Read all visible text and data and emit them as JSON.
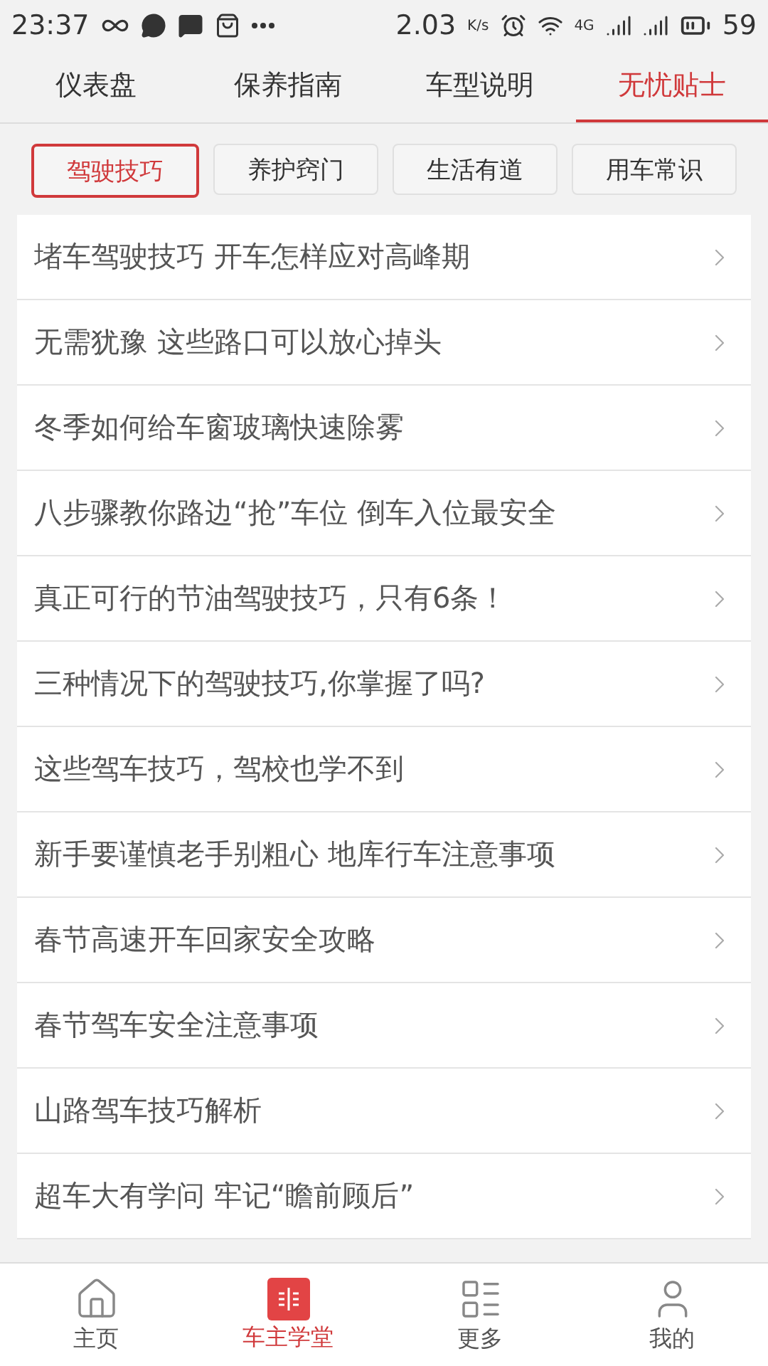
{
  "status_bar": {
    "time": "23:37",
    "speed": "2.03",
    "speed_unit": "K/s",
    "network": "4G",
    "battery": "59"
  },
  "tabs": [
    {
      "label": "仪表盘",
      "selected": false
    },
    {
      "label": "保养指南",
      "selected": false
    },
    {
      "label": "车型说明",
      "selected": false
    },
    {
      "label": "无忧贴士",
      "selected": true
    }
  ],
  "categories": [
    {
      "label": "驾驶技巧",
      "selected": true
    },
    {
      "label": "养护窍门",
      "selected": false
    },
    {
      "label": "生活有道",
      "selected": false
    },
    {
      "label": "用车常识",
      "selected": false
    }
  ],
  "articles": [
    "堵车驾驶技巧 开车怎样应对高峰期",
    "无需犹豫 这些路口可以放心掉头",
    "冬季如何给车窗玻璃快速除雾",
    "八步骤教你路边“抢”车位 倒车入位最安全",
    "真正可行的节油驾驶技巧，只有6条！",
    "三种情况下的驾驶技巧,你掌握了吗?",
    "这些驾车技巧，驾校也学不到",
    "新手要谨慎老手别粗心 地库行车注意事项",
    "春节高速开车回家安全攻略",
    "春节驾车安全注意事项",
    "山路驾车技巧解析",
    "超车大有学问 牢记“瞻前顾后”"
  ],
  "nav": [
    {
      "label": "主页",
      "kind": "home",
      "selected": false
    },
    {
      "label": "车主学堂",
      "kind": "school",
      "selected": true
    },
    {
      "label": "更多",
      "kind": "more",
      "selected": false
    },
    {
      "label": "我的",
      "kind": "me",
      "selected": false
    }
  ]
}
